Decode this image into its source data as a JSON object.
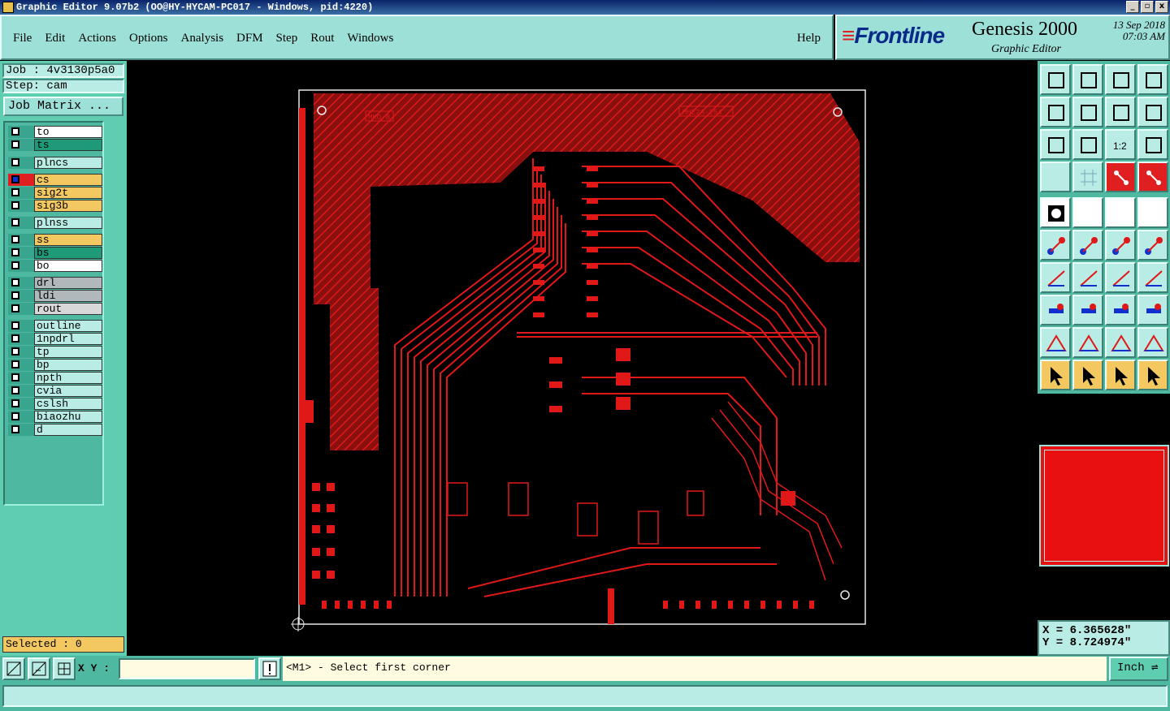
{
  "window": {
    "title": "Graphic Editor 9.07b2  (OO@HY-HYCAM-PC017 - Windows, pid:4220)",
    "controls": [
      "_",
      "▫",
      "x"
    ]
  },
  "menu": {
    "items": [
      "File",
      "Edit",
      "Actions",
      "Options",
      "Analysis",
      "DFM",
      "Step",
      "Rout",
      "Windows"
    ],
    "help": "Help"
  },
  "brand": {
    "logo": "Frontline",
    "product": "Genesis 2000",
    "subtitle": "Graphic Editor",
    "date": "13  Sep  2018",
    "time": "07:03  AM"
  },
  "job": {
    "job_label": "Job : 4v3130p5a0",
    "step_label": "Step: cam",
    "matrix_button": "Job Matrix ..."
  },
  "layers": [
    {
      "name": "to",
      "color": "#ffffff"
    },
    {
      "name": "ts",
      "color": "#1f9a78"
    },
    {
      "name": "plncs",
      "color": "#b9ece4"
    },
    {
      "name": "cs",
      "color": "#f4c860",
      "active": true
    },
    {
      "name": "sig2t",
      "color": "#f4c860"
    },
    {
      "name": "sig3b",
      "color": "#f4c860"
    },
    {
      "name": "plnss",
      "color": "#b9ece4"
    },
    {
      "name": "ss",
      "color": "#f4c860"
    },
    {
      "name": "bs",
      "color": "#1f9a78"
    },
    {
      "name": "bo",
      "color": "#ffffff"
    },
    {
      "name": "drl",
      "color": "#b0b8bc"
    },
    {
      "name": "ldi",
      "color": "#b0b8bc"
    },
    {
      "name": "rout",
      "color": "#d8d8d8"
    },
    {
      "name": "outline",
      "color": "#b9ece4"
    },
    {
      "name": "1npdrl",
      "color": "#b9ece4"
    },
    {
      "name": "tp",
      "color": "#b9ece4"
    },
    {
      "name": "bp",
      "color": "#b9ece4"
    },
    {
      "name": "npth",
      "color": "#b9ece4"
    },
    {
      "name": "cvia",
      "color": "#b9ece4"
    },
    {
      "name": "cslsh",
      "color": "#b9ece4"
    },
    {
      "name": "biaozhu",
      "color": "#b9ece4"
    },
    {
      "name": "d",
      "color": "#b9ece4"
    }
  ],
  "selected_label": "Selected : 0",
  "board_labels": {
    "left_tag": "MKO-8",
    "right_tag": "MHE2A-254"
  },
  "tools": {
    "row_labels": [
      "1:2"
    ]
  },
  "coordinates": {
    "x": "X = 6.365628\"",
    "y": "Y = 8.724974\""
  },
  "bottom": {
    "xy_label": "X Y :",
    "xy_value": "",
    "message": "<M1> - Select first corner",
    "unit": "Inch"
  },
  "colors": {
    "copper": "#e01818",
    "panel": "#9ce0d8",
    "accent": "#4fb8a0"
  }
}
